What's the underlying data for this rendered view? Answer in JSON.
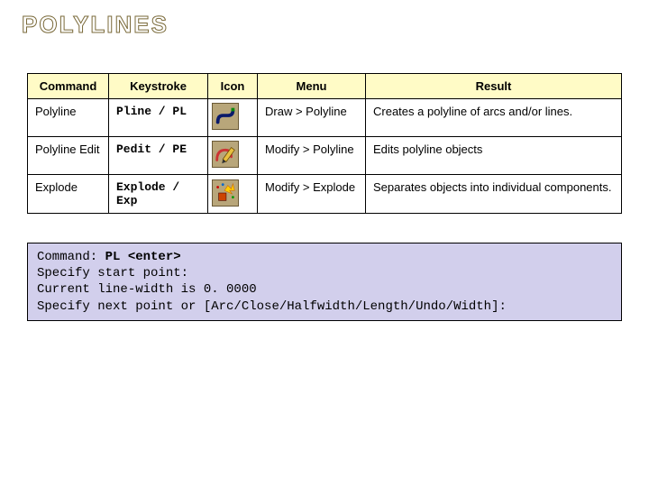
{
  "title": "POLYLINES",
  "headers": [
    "Command",
    "Keystroke",
    "Icon",
    "Menu",
    "Result"
  ],
  "rows": [
    {
      "command": "Polyline",
      "keystroke": "Pline  / PL",
      "icon": "polyline-icon",
      "menu": "Draw > Polyline",
      "result": "Creates a polyline of arcs and/or lines."
    },
    {
      "command": "Polyline Edit",
      "keystroke": "Pedit / PE",
      "icon": "polyline-edit-icon",
      "menu": "Modify > Polyline",
      "result": "Edits polyline objects"
    },
    {
      "command": "Explode",
      "keystroke": "Explode / Exp",
      "icon": "explode-icon",
      "menu": "Modify > Explode",
      "result": "Separates objects into individual components."
    }
  ],
  "console": {
    "line1a": "Command: ",
    "line1b": "PL <enter>",
    "line2": "Specify start point:",
    "line3": "Current line-width is 0. 0000",
    "line4": "Specify next point or [Arc/Close/Halfwidth/Length/Undo/Width]:"
  }
}
